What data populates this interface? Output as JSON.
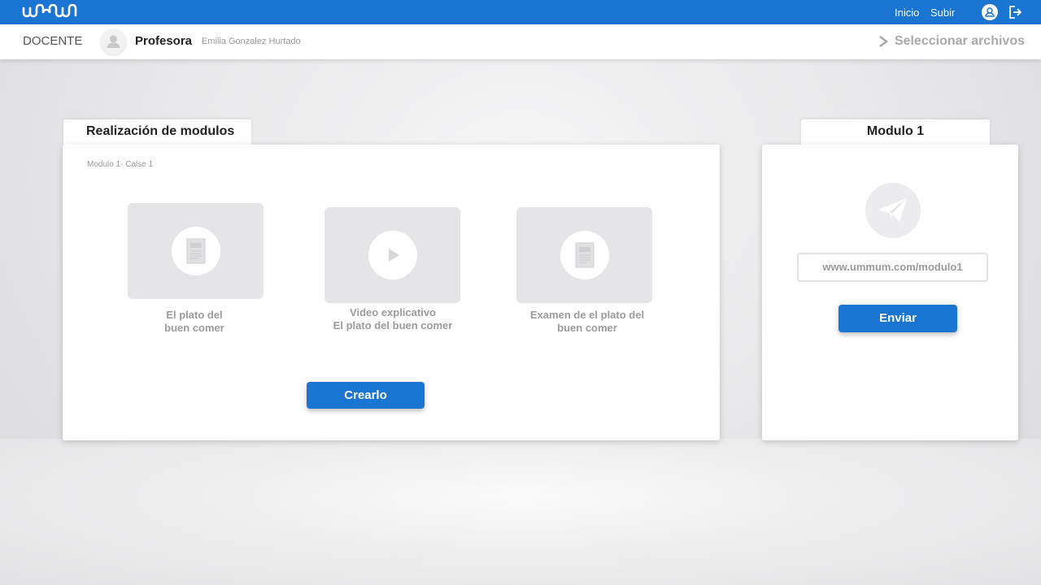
{
  "topbar": {
    "logo_text": "ummum",
    "nav": {
      "inicio": "Inicio",
      "subir": "Subir"
    },
    "bg_color": "#1a74d2"
  },
  "subheader": {
    "section": "DOCENTE",
    "role": "Profesora",
    "teacher_name": "Emilia Gonzalez Hurtado",
    "select_files": "Seleccionar archivos"
  },
  "left_panel": {
    "tab_title": "Realización de modulos",
    "breadcrumb": "Modulo 1- Calse 1",
    "cards": [
      {
        "icon": "document-icon",
        "caption_line1": "El plato del",
        "caption_line2": "buen comer"
      },
      {
        "icon": "play-icon",
        "caption_line1": "Video explicativo",
        "caption_line2": "El plato del buen comer"
      },
      {
        "icon": "document-icon",
        "caption_line1": "Examen de el plato del",
        "caption_line2": "buen comer"
      }
    ],
    "create_button": "Crearlo"
  },
  "right_panel": {
    "tab_title": "Modulo 1",
    "icon": "paper-plane-icon",
    "url": "www.ummum.com/modulo1",
    "send_button": "Enviar"
  }
}
